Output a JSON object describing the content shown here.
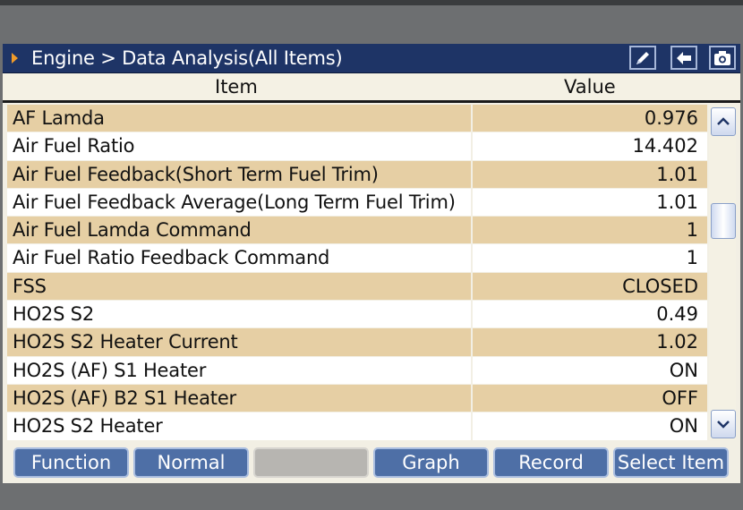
{
  "header": {
    "breadcrumb": "Engine > Data Analysis(All Items)"
  },
  "title_buttons": [
    {
      "icon": "pen-icon"
    },
    {
      "icon": "back-arrow-icon"
    },
    {
      "icon": "camera-icon"
    }
  ],
  "columns": {
    "item": "Item",
    "value": "Value"
  },
  "rows": [
    {
      "name": "AF Lamda",
      "value": "0.976"
    },
    {
      "name": "Air Fuel Ratio",
      "value": "14.402"
    },
    {
      "name": "Air Fuel Feedback(Short Term Fuel Trim)",
      "value": "1.01"
    },
    {
      "name": "Air Fuel Feedback Average(Long Term Fuel Trim)",
      "value": "1.01"
    },
    {
      "name": "Air Fuel Lamda Command",
      "value": "1"
    },
    {
      "name": "Air Fuel Ratio Feedback Command",
      "value": "1"
    },
    {
      "name": "FSS",
      "value": "CLOSED"
    },
    {
      "name": "HO2S S2",
      "value": "0.49"
    },
    {
      "name": "HO2S S2 Heater Current",
      "value": "1.02"
    },
    {
      "name": "HO2S (AF) S1 Heater",
      "value": "ON"
    },
    {
      "name": "HO2S (AF) B2 S1 Heater",
      "value": "OFF"
    },
    {
      "name": "HO2S S2 Heater",
      "value": "ON"
    }
  ],
  "function_buttons": [
    {
      "label": "Function"
    },
    {
      "label": "Normal"
    },
    {
      "label": ""
    },
    {
      "label": "Graph"
    },
    {
      "label": "Record"
    },
    {
      "label": "Select Item"
    }
  ],
  "colors": {
    "title_bar": "#1e3466",
    "row_alt": "#e6cfa4",
    "row": "#ffffff",
    "button": "#4e6fa6",
    "button_disabled": "#b7b5b1",
    "accent_arrow": "#f09b2a"
  },
  "scroll": {
    "position_fraction": 0.28
  }
}
